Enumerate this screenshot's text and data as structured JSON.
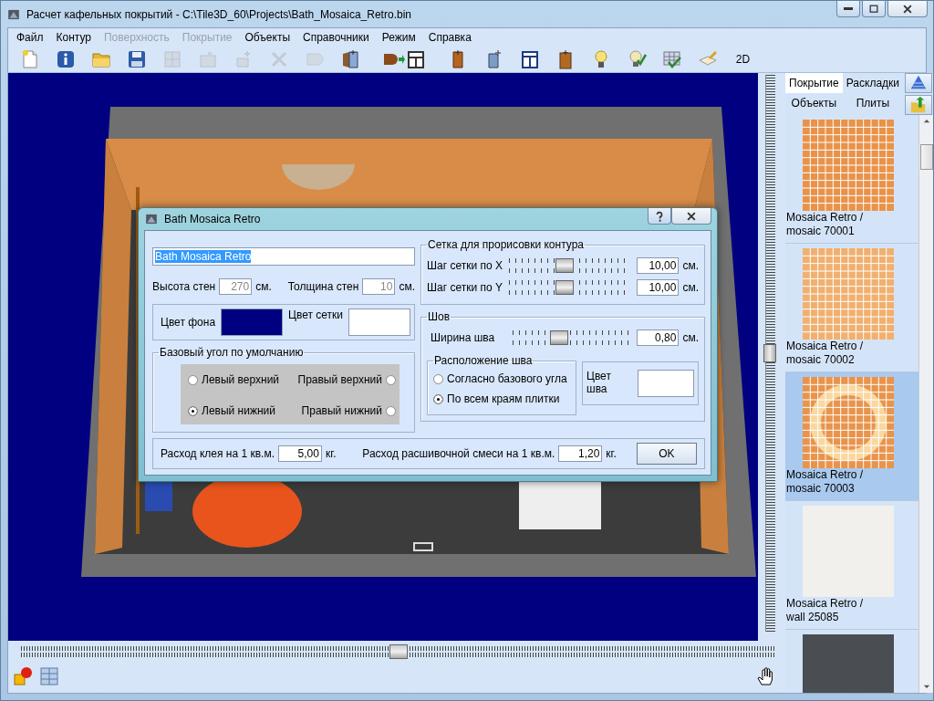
{
  "window": {
    "title": "Расчет кафельных покрытий - C:\\Tile3D_60\\Projects\\Bath_Mosaica_Retro.bin"
  },
  "menu": [
    {
      "label": "Файл",
      "disabled": false
    },
    {
      "label": "Контур",
      "disabled": false
    },
    {
      "label": "Поверхность",
      "disabled": true
    },
    {
      "label": "Покрытие",
      "disabled": true
    },
    {
      "label": "Объекты",
      "disabled": false
    },
    {
      "label": "Справочники",
      "disabled": false
    },
    {
      "label": "Режим",
      "disabled": false
    },
    {
      "label": "Справка",
      "disabled": false
    }
  ],
  "toolbar": {
    "buttons": [
      {
        "disabled": false
      },
      {
        "disabled": false
      },
      {
        "disabled": false
      },
      {
        "disabled": false
      },
      {
        "disabled": true
      },
      {
        "disabled": true
      },
      {
        "disabled": true
      },
      {
        "disabled": true
      },
      {
        "disabled": true
      },
      {
        "disabled": false
      },
      {
        "disabled": false
      },
      {
        "disabled": false
      },
      {
        "disabled": false
      },
      {
        "disabled": false
      },
      {
        "disabled": false
      },
      {
        "disabled": false
      },
      {
        "disabled": false
      },
      {
        "disabled": false
      },
      {
        "disabled": false
      }
    ],
    "mode_button": {
      "label": "2D"
    }
  },
  "viewport": {
    "vertical_slider": {
      "level": 0.5
    },
    "horizontal_slider": {
      "level": 0.5
    }
  },
  "dialog": {
    "title": "Bath Mosaica Retro",
    "name_value": "Bath Mosaica Retro",
    "wall_height": {
      "label": "Высота стен",
      "value": "270",
      "unit": "см.",
      "disabled": true
    },
    "wall_thickness": {
      "label": "Толщина стен",
      "value": "10",
      "unit": "см.",
      "disabled": true
    },
    "background_color": {
      "label": "Цвет фона",
      "color": "#000080"
    },
    "grid_color": {
      "label": "Цвет сетки",
      "color": "#ffffff"
    },
    "base_corner": {
      "title": "Базовый угол по умолчанию",
      "options": [
        {
          "label": "Левый верхний",
          "selected": false
        },
        {
          "label": "Правый верхний",
          "selected": false
        },
        {
          "label": "Левый нижний",
          "selected": true
        },
        {
          "label": "Правый нижний",
          "selected": false
        }
      ]
    },
    "grid": {
      "title": "Сетка для прорисовки контура",
      "rows": [
        {
          "label": "Шаг сетки по X",
          "level": 0.48,
          "value": "10,00",
          "unit": "см."
        },
        {
          "label": "Шаг сетки по Y",
          "level": 0.48,
          "value": "10,00",
          "unit": "см."
        }
      ]
    },
    "seam": {
      "title": "Шов",
      "width": {
        "label": "Ширина шва",
        "level": 0.4,
        "value": "0,80",
        "unit": "см."
      },
      "placement": {
        "title": "Расположение шва",
        "options": [
          {
            "label": "Согласно базового угла",
            "selected": false
          },
          {
            "label": "По всем краям плитки",
            "selected": true
          }
        ]
      },
      "seam_color": {
        "label": "Цвет шва",
        "color": "#ffffff"
      }
    },
    "glue": {
      "label": "Расход клея на 1 кв.м.",
      "value": "5,00",
      "unit": "кг."
    },
    "grout": {
      "label": "Расход расшивочной смеси на 1 кв.м.",
      "value": "1,20",
      "unit": "кг."
    },
    "ok_label": "OK"
  },
  "panel": {
    "tabs": [
      {
        "label": "Покрытие",
        "selected": true
      },
      {
        "label": "Раскладки",
        "selected": false
      },
      {
        "label": "Объекты",
        "selected": false
      },
      {
        "label": "Плиты",
        "selected": false
      }
    ],
    "tiles": [
      {
        "caption": "Mosaica Retro / mosaic 70001",
        "kind": "mosaic",
        "color": "#e8924a",
        "selected": false
      },
      {
        "caption": "Mosaica Retro / mosaic 70002",
        "kind": "mosaic",
        "color": "#f0b070",
        "selected": false
      },
      {
        "caption": "Mosaica Retro / mosaic 70003",
        "kind": "ring",
        "color": "#e8944c",
        "selected": true
      },
      {
        "caption": "Mosaica Retro / wall 25085",
        "kind": "plain",
        "color": "#f2f0ec",
        "selected": false
      },
      {
        "kind": "plain",
        "color": "#4a4d52",
        "selected": false
      }
    ]
  }
}
